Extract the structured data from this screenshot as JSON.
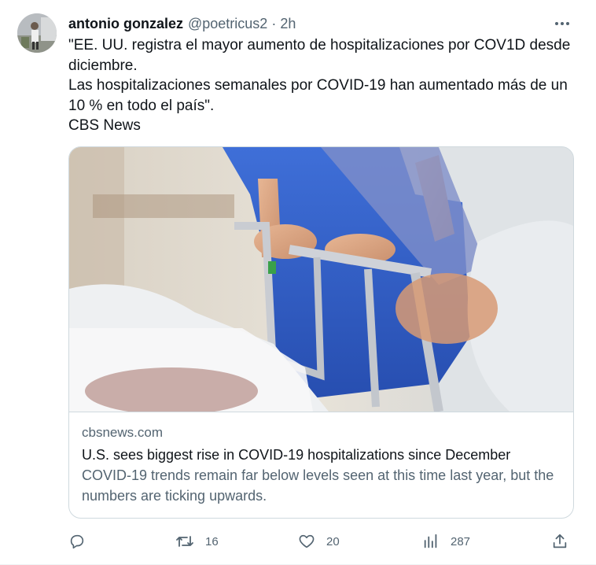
{
  "tweet": {
    "author_name": "antonio gonzalez",
    "handle": "@poetricus2",
    "separator": "·",
    "time": "2h",
    "text_lines": [
      "\"EE. UU. registra el mayor aumento de hospitalizaciones por COV1D  desde diciembre.",
      "Las hospitalizaciones semanales por COVID-19 han aumentado más de un 10 % en todo el país\".",
      "CBS News"
    ],
    "card": {
      "domain": "cbsnews.com",
      "title": "U.S. sees biggest rise in COVID-19 hospitalizations since December",
      "description": "COVID-19 trends remain far below levels seen at this time last year, but the numbers are ticking upwards.",
      "image_icon": "hospital-gurney-photo"
    },
    "actions": {
      "reply_count": "",
      "retweet_count": "16",
      "like_count": "20",
      "views_count": "287"
    }
  },
  "icons": {
    "more": "more-icon",
    "reply": "reply-icon",
    "retweet": "retweet-icon",
    "like": "heart-icon",
    "views": "views-icon",
    "share": "share-icon"
  },
  "colors": {
    "text_primary": "#0f1419",
    "text_secondary": "#536471",
    "border": "#cfd9de"
  }
}
